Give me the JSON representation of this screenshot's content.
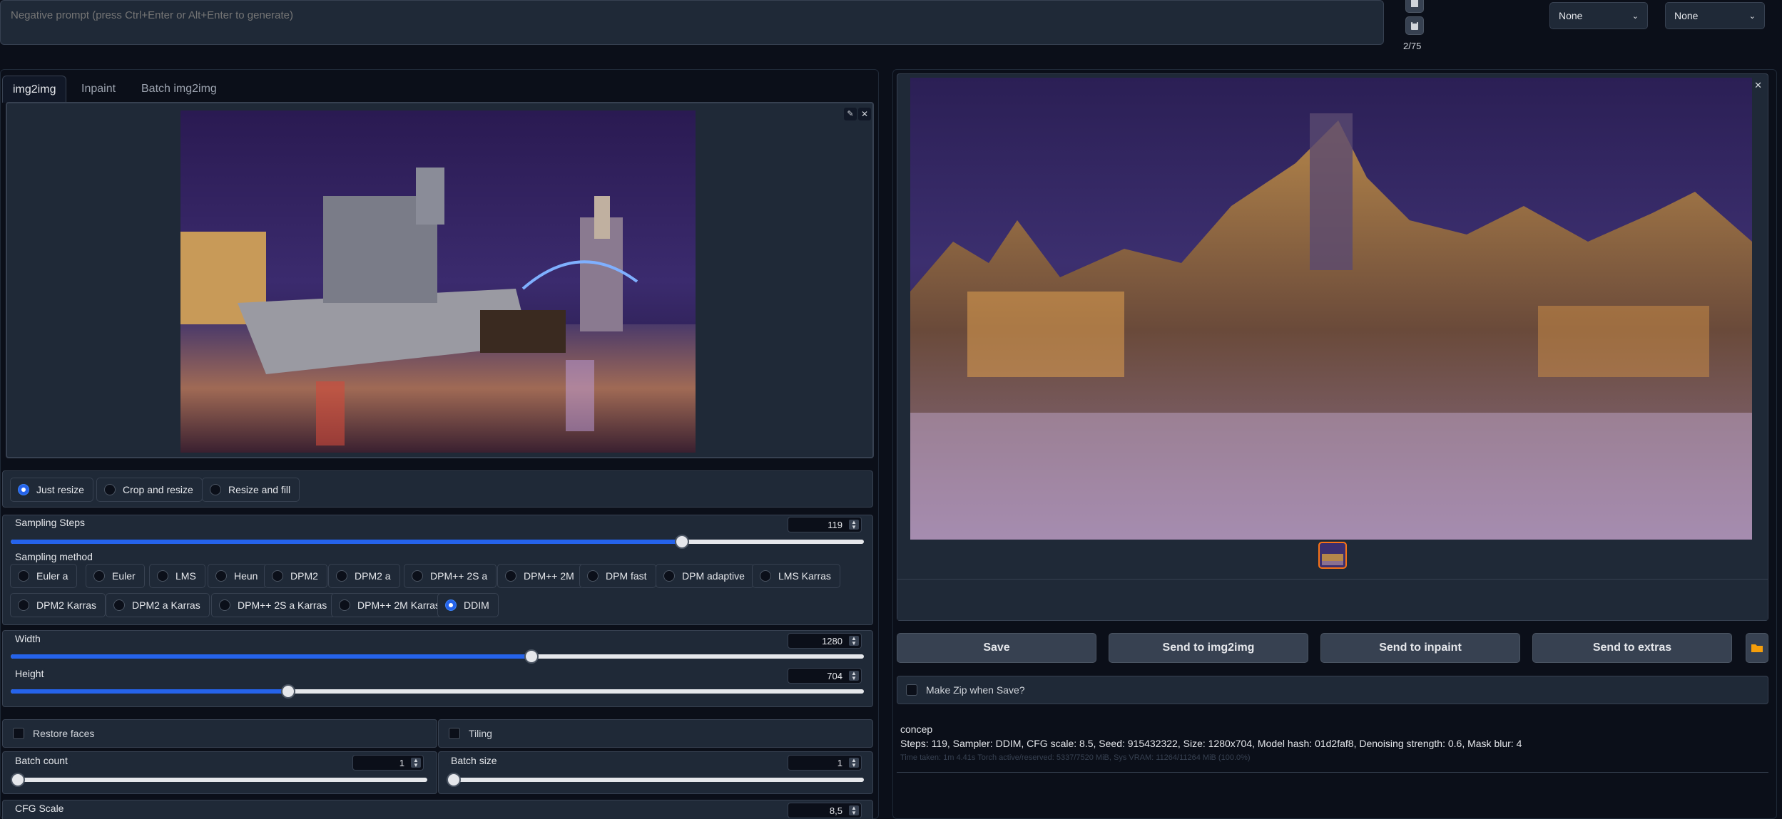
{
  "prompt": {
    "negative_placeholder": "Negative prompt (press Ctrl+Enter or Alt+Enter to generate)",
    "token_count": "2/75"
  },
  "styles": {
    "style1": "None",
    "style2": "None"
  },
  "tabs": [
    "img2img",
    "Inpaint",
    "Batch img2img"
  ],
  "resize_modes": [
    {
      "label": "Just resize",
      "selected": true
    },
    {
      "label": "Crop and resize",
      "selected": false
    },
    {
      "label": "Resize and fill",
      "selected": false
    }
  ],
  "sampling_steps": {
    "label": "Sampling Steps",
    "value": "119",
    "fraction": 0.787
  },
  "sampling_method": {
    "label": "Sampling method",
    "options": [
      "Euler a",
      "Euler",
      "LMS",
      "Heun",
      "DPM2",
      "DPM2 a",
      "DPM++ 2S a",
      "DPM++ 2M",
      "DPM fast",
      "DPM adaptive",
      "LMS Karras",
      "DPM2 Karras",
      "DPM2 a Karras",
      "DPM++ 2S a Karras",
      "DPM++ 2M Karras",
      "DDIM"
    ],
    "selected": "DDIM"
  },
  "width": {
    "label": "Width",
    "value": "1280",
    "fraction": 0.61
  },
  "height": {
    "label": "Height",
    "value": "704",
    "fraction": 0.325
  },
  "restore_faces": {
    "label": "Restore faces",
    "checked": false
  },
  "tiling": {
    "label": "Tiling",
    "checked": false
  },
  "batch_count": {
    "label": "Batch count",
    "value": "1",
    "fraction": 0
  },
  "batch_size": {
    "label": "Batch size",
    "value": "1",
    "fraction": 0
  },
  "cfg_scale": {
    "label": "CFG Scale",
    "value": "8,5"
  },
  "actions": {
    "save": "Save",
    "send_img2img": "Send to img2img",
    "send_inpaint": "Send to inpaint",
    "send_extras": "Send to extras"
  },
  "make_zip": {
    "label": "Make Zip when Save?",
    "checked": false
  },
  "output_info": {
    "prompt": "concep",
    "params": "Steps: 119, Sampler: DDIM, CFG scale: 8.5, Seed: 915432322, Size: 1280x704, Model hash: 01d2faf8, Denoising strength: 0.6, Mask blur: 4",
    "timing": "Time taken: 1m 4.41s   Torch active/reserved: 5337/7520 MiB, Sys VRAM: 11264/11264 MiB (100.0%)"
  },
  "colors": {
    "accent": "#2563eb",
    "thumbnail_border": "#f97316",
    "bg": "#0b0f19"
  }
}
